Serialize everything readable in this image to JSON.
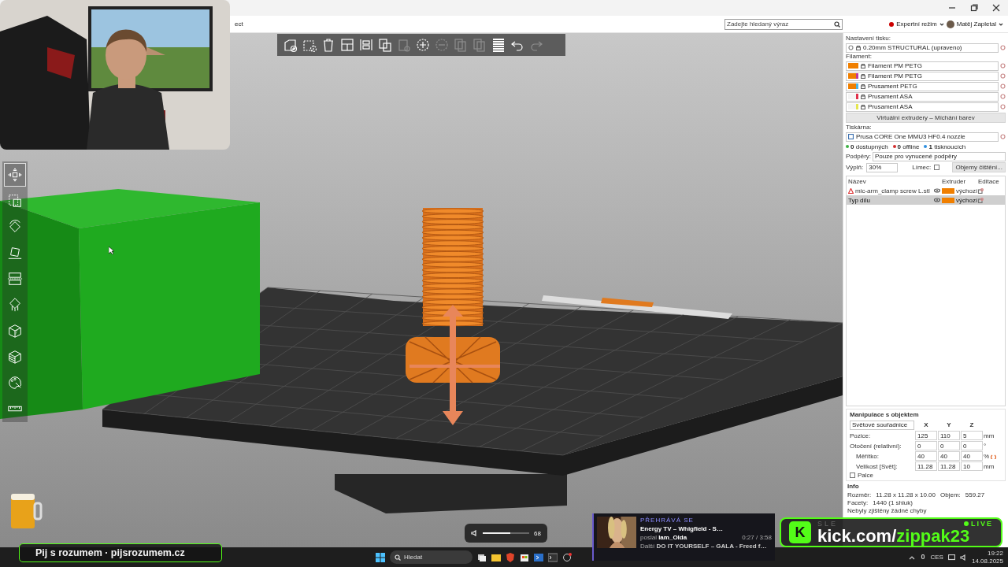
{
  "menu_bar": {
    "menu_fragment": "ect",
    "search": {
      "placeholder": "Zadejte hledaný výraz"
    },
    "mode": "Expertní režim",
    "user": "Matěj Zapletal"
  },
  "top_toolbar": [
    {
      "disabled": false
    },
    {
      "disabled": false
    },
    {
      "disabled": false
    },
    {
      "disabled": false
    },
    {
      "disabled": false
    },
    {
      "disabled": false
    },
    {
      "disabled": true
    },
    {
      "disabled": false
    },
    {
      "disabled": true
    },
    {
      "disabled": true
    },
    {
      "disabled": true
    },
    {
      "disabled": false
    },
    {
      "disabled": false
    },
    {
      "disabled": true
    }
  ],
  "left_toolbar": [
    {
      "selected": true
    },
    {
      "selected": false
    },
    {
      "selected": false
    },
    {
      "selected": false
    },
    {
      "selected": false
    },
    {
      "selected": false
    },
    {
      "selected": false
    },
    {
      "selected": false
    },
    {
      "selected": false
    },
    {
      "selected": false
    }
  ],
  "right_panel": {
    "print_settings": {
      "label": "Nastavení tisku:",
      "value": "0.20mm STRUCTURAL (upraveno)"
    },
    "filament_label": "Filament:",
    "filaments": [
      {
        "name": "Filament PM PETG",
        "swatches": [
          {
            "color": "#f07f00"
          },
          {
            "color": "#f07f00"
          }
        ]
      },
      {
        "name": "Filament PM PETG",
        "swatches": [
          {
            "color": "#f07f00"
          },
          {
            "color": "#c03a9c"
          }
        ]
      },
      {
        "name": "Prusament PETG",
        "swatches": [
          {
            "color": "#f07f00"
          },
          {
            "color": "#4ab4e6"
          }
        ]
      },
      {
        "name": "Prusament ASA",
        "swatches": [
          {
            "color": "#f4f4f4"
          },
          {
            "color": "#e0304a"
          }
        ]
      },
      {
        "name": "Prusament ASA",
        "swatches": [
          {
            "color": "#f4f4f4"
          },
          {
            "color": "#e4e650"
          }
        ]
      }
    ],
    "mix_button": "Virtuální extrudery – Míchání barev",
    "printer": {
      "label": "Tiskárna:",
      "value": "Prusa CORE One MMU3 HF0.4 nozzle"
    },
    "printer_status": [
      {
        "text": "**0** dostupných",
        "color": "#3cb043"
      },
      {
        "text": "**0** offline",
        "color": "#d32f2f"
      },
      {
        "text": "**1** tisknoucích",
        "color": "#2f8fe0"
      }
    ],
    "supports": {
      "label": "Podpěry:",
      "value": "Pouze pro vynucené podpěry"
    },
    "infill": {
      "label": "Výplň:",
      "value": "30%"
    },
    "brim": {
      "label": "Límec:",
      "checked": false
    },
    "purge_button": "Objemy čištění...",
    "object_list": {
      "columns": [
        "Název",
        "Extruder",
        "Editace"
      ],
      "rows": [
        {
          "name": "mic-arm_clamp screw L.stl",
          "warning": true,
          "extruder": "výchozí",
          "selected": false
        },
        {
          "name": "Typ dílu",
          "warning": false,
          "extruder": "výchozí",
          "selected": true
        }
      ]
    },
    "manipulation": {
      "title": "Manipulace s objektem",
      "coordinates": "Světové souřadnice",
      "axes": [
        "X",
        "Y",
        "Z"
      ],
      "rows": [
        {
          "label": "Pozice:",
          "values": [
            "125",
            "110",
            "5"
          ],
          "unit": "mm",
          "reset": false
        },
        {
          "label": "Otočení (relativní):",
          "values": [
            "0",
            "0",
            "0"
          ],
          "unit": "°",
          "reset": false
        },
        {
          "label": "Měřítko:",
          "values": [
            "40",
            "40",
            "40"
          ],
          "unit": "%",
          "reset": true
        },
        {
          "label": "Velikost [Svět]:",
          "values": [
            "11.28",
            "11.28",
            "10"
          ],
          "unit": "mm",
          "reset": false
        }
      ],
      "inches": {
        "label": "Palce",
        "checked": false
      }
    },
    "info": {
      "title": "Info",
      "rows": [
        {
          "label": "Rozměr:",
          "value": "11.28 x 11.28 x 10.00",
          "extra_label": "Objem:",
          "extra_value": "559.27"
        },
        {
          "label": "Facety:",
          "value": "1440 (1 shluk)"
        }
      ],
      "message": "Nebyly zjištěny žádné chyby"
    }
  },
  "overlays": {
    "volume": {
      "level": 0.6,
      "reading": "68"
    },
    "now_playing": {
      "status": "PŘEHRÁVÁ SE",
      "title": "Energy TV – Whigfield - S…",
      "by_label": "poslal",
      "by_user": "Iam_Olda",
      "time": "0:27 / 3:58",
      "next_label": "Další",
      "next_title": "DO IT YOURSELF – GALA - Freed f…"
    },
    "kick": {
      "logo": "K",
      "faded": "SLE",
      "live": "LIVE",
      "prefix": "kick.com/",
      "handle": "zippak23"
    },
    "sponsor_banner": "Pij s rozumem · pijsrozumem.cz"
  },
  "taskbar": {
    "search_placeholder": "Hledat",
    "language": "CES",
    "time": "19:22",
    "date": "14.08.2025"
  }
}
